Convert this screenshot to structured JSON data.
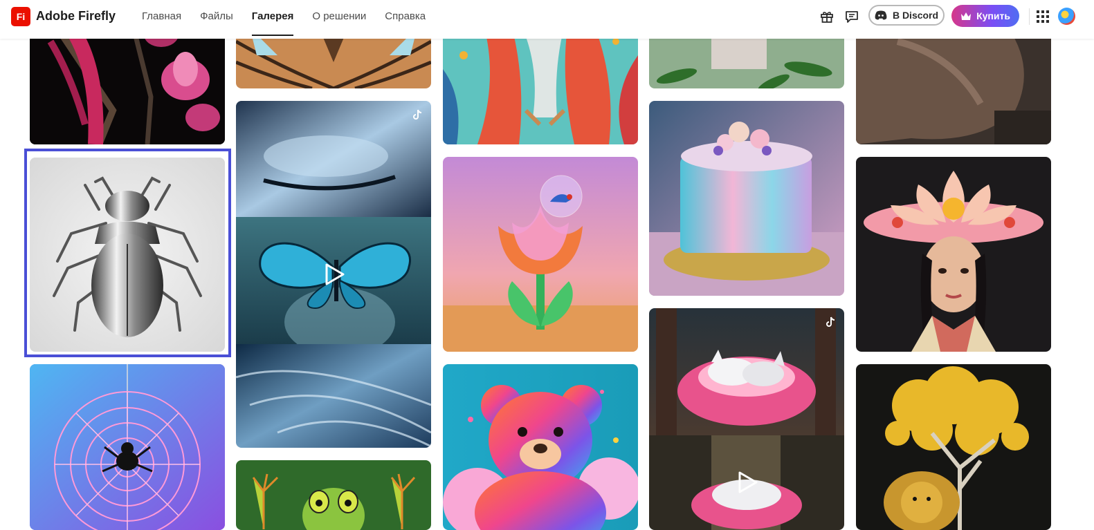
{
  "app": {
    "logo_text": "Fi",
    "name": "Adobe Firefly"
  },
  "nav": {
    "items": [
      {
        "label": "Главная",
        "active": false
      },
      {
        "label": "Файлы",
        "active": false
      },
      {
        "label": "Галерея",
        "active": true
      },
      {
        "label": "О решении",
        "active": false
      },
      {
        "label": "Справка",
        "active": false
      }
    ]
  },
  "actions": {
    "gift_icon": "gift-icon",
    "chat_icon": "chat-icon",
    "discord_label": "В Discord",
    "buy_label": "Купить",
    "apps_icon": "apps-grid-icon",
    "avatar_icon": "avatar"
  },
  "colors": {
    "accent": "#4a4fd6",
    "brand": "#eb1000"
  },
  "gallery": {
    "tiles": [
      {
        "subject": "magenta magnolia with bird feathers",
        "selected": false
      },
      {
        "subject": "chrome beetle",
        "selected": true
      },
      {
        "subject": "neon spider web with spider",
        "selected": false
      },
      {
        "subject": "owl feathers",
        "selected": false
      },
      {
        "subject": "blue butterfly on face",
        "selected": false,
        "video": true,
        "tiktok": true
      },
      {
        "subject": "green frog hands",
        "selected": false
      },
      {
        "subject": "paper-craft feathered figure",
        "selected": false
      },
      {
        "subject": "glass tulip with blue bird",
        "selected": false
      },
      {
        "subject": "rainbow teddy bear",
        "selected": false
      },
      {
        "subject": "green leaves on table",
        "selected": false
      },
      {
        "subject": "pastel painted cake",
        "selected": false
      },
      {
        "subject": "sleeping white fox in pink nest",
        "selected": false,
        "video": true,
        "tiktok": true
      },
      {
        "subject": "animal fur",
        "selected": false
      },
      {
        "subject": "woman with lotus flower hat",
        "selected": false
      },
      {
        "subject": "golden tree with lion",
        "selected": false
      }
    ]
  }
}
